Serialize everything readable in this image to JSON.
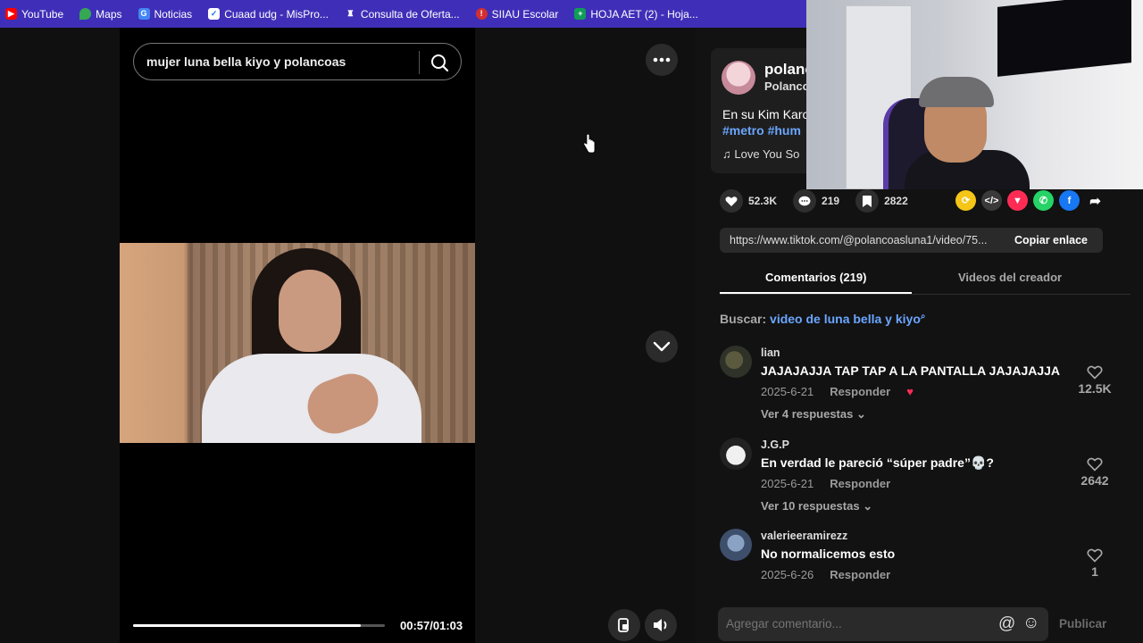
{
  "bookmarks": [
    {
      "label": "YouTube",
      "icon": "youtube-icon",
      "color": "#ff0000"
    },
    {
      "label": "Maps",
      "icon": "maps-icon",
      "color": "#34a853"
    },
    {
      "label": "Noticias",
      "icon": "news-icon",
      "color": "#4285f4"
    },
    {
      "label": "Cuaad udg - MisPro...",
      "icon": "check-icon",
      "color": "#1a73e8"
    },
    {
      "label": "Consulta de Oferta...",
      "icon": "udg-icon",
      "color": "#ffffff"
    },
    {
      "label": "SIIAU Escolar",
      "icon": "siiau-icon",
      "color": "#d32f2f"
    },
    {
      "label": "HOJA AET (2) - Hoja...",
      "icon": "sheets-icon",
      "color": "#0f9d58"
    }
  ],
  "search": {
    "query": "mujer luna bella kiyo y polancoas"
  },
  "video": {
    "time": "00:57/01:03",
    "progress": 0.905
  },
  "post": {
    "author": "polanc",
    "author_sub": "Polancoa",
    "description": "En su Kim Karc",
    "hashtags": "#metro #hum",
    "music": "Love You So"
  },
  "stats": {
    "likes": "52.3K",
    "comments": "219",
    "saves": "2822"
  },
  "share_colors": [
    "#f5c518",
    "#3a3a3a",
    "#fe2c55",
    "#25d366",
    "#1877f2"
  ],
  "link": {
    "url": "https://www.tiktok.com/@polancoasluna1/video/75...",
    "copy_label": "Copiar enlace"
  },
  "tabs": {
    "comments": "Comentarios (219)",
    "creator": "Videos del creador"
  },
  "buscar": {
    "label": "Buscar:",
    "query": "video de luna bella y kiyo"
  },
  "comments": [
    {
      "user": "lian",
      "text": "JAJAJAJJA TAP TAP A LA PANTALLA JAJAJAJJA",
      "date": "2025-6-21",
      "reply": "Responder",
      "more": "Ver 4 respuestas",
      "likes": "12.5K"
    },
    {
      "user": "J.G.P",
      "text": "En verdad le pareció “súper padre”💀?",
      "date": "2025-6-21",
      "reply": "Responder",
      "more": "Ver 10 respuestas",
      "likes": "2642"
    },
    {
      "user": "valerieeramirezz",
      "text": "No normalicemos esto",
      "date": "2025-6-26",
      "reply": "Responder",
      "more": "",
      "likes": "1"
    }
  ],
  "compose": {
    "placeholder": "Agregar comentario...",
    "publish": "Publicar"
  }
}
